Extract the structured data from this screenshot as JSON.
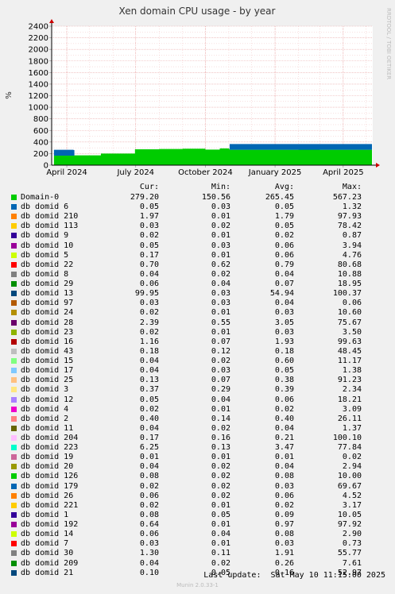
{
  "chart_data": {
    "type": "area",
    "title": "Xen domain CPU usage - by year",
    "ylabel": "%",
    "ylim": [
      0,
      2400
    ],
    "y_ticks": [
      0,
      200,
      400,
      600,
      800,
      1000,
      1200,
      1400,
      1600,
      1800,
      2000,
      2200,
      2400
    ],
    "x_range": [
      "2024-03-12",
      "2025-05-10"
    ],
    "x_ticks": [
      {
        "date": "2024-04-01",
        "label": "April 2024"
      },
      {
        "date": "2024-07-01",
        "label": "July 2024"
      },
      {
        "date": "2024-10-01",
        "label": "October 2024"
      },
      {
        "date": "2025-01-01",
        "label": "January 2025"
      },
      {
        "date": "2025-04-01",
        "label": "April 2025"
      }
    ],
    "side_label": "RRDTOOL / TOBI OETIKER",
    "grid": true,
    "stacked": true,
    "series": [
      {
        "name": "Domain-0",
        "color": "#00cc00",
        "x": [
          "2024-03-15",
          "2024-04-10",
          "2024-04-11",
          "2024-05-15",
          "2024-05-16",
          "2024-06-30",
          "2024-08-01",
          "2024-09-01",
          "2024-10-01",
          "2024-10-20",
          "2024-11-01",
          "2024-11-02",
          "2024-12-15",
          "2025-02-01",
          "2025-03-01",
          "2025-04-01",
          "2025-05-09"
        ],
        "values": [
          165,
          165,
          170,
          170,
          200,
          275,
          280,
          285,
          270,
          290,
          280,
          265,
          265,
          270,
          265,
          265,
          265
        ]
      },
      {
        "name": "db domid 13",
        "color": "#0066b3",
        "x": [
          "2024-03-15",
          "2024-04-10",
          "2024-04-11",
          "2024-11-01",
          "2024-11-02",
          "2025-05-09"
        ],
        "values": [
          100,
          95,
          0,
          0,
          100,
          100
        ]
      }
    ]
  },
  "legend": {
    "headers": [
      "Cur:",
      "Min:",
      "Avg:",
      "Max:"
    ],
    "rows": [
      {
        "name": "Domain-0",
        "color": "#00cc00",
        "cur": "279.20",
        "min": "150.56",
        "avg": "265.45",
        "max": "567.23"
      },
      {
        "name": "db domid 6",
        "color": "#0066b3",
        "cur": "0.05",
        "min": "0.03",
        "avg": "0.05",
        "max": "1.32"
      },
      {
        "name": "db domid 210",
        "color": "#ff8000",
        "cur": "1.97",
        "min": "0.01",
        "avg": "1.79",
        "max": "97.93"
      },
      {
        "name": "db domid 113",
        "color": "#ffcc00",
        "cur": "0.03",
        "min": "0.02",
        "avg": "0.05",
        "max": "78.42"
      },
      {
        "name": "db domid 9",
        "color": "#330099",
        "cur": "0.02",
        "min": "0.01",
        "avg": "0.02",
        "max": "0.87"
      },
      {
        "name": "db domid 10",
        "color": "#990099",
        "cur": "0.05",
        "min": "0.03",
        "avg": "0.06",
        "max": "3.94"
      },
      {
        "name": "db domid 5",
        "color": "#ccff00",
        "cur": "0.17",
        "min": "0.01",
        "avg": "0.06",
        "max": "4.76"
      },
      {
        "name": "db domid 22",
        "color": "#ff0000",
        "cur": "0.70",
        "min": "0.62",
        "avg": "0.79",
        "max": "80.68"
      },
      {
        "name": "db domid 8",
        "color": "#808080",
        "cur": "0.04",
        "min": "0.02",
        "avg": "0.04",
        "max": "10.88"
      },
      {
        "name": "db domid 29",
        "color": "#008f00",
        "cur": "0.06",
        "min": "0.04",
        "avg": "0.07",
        "max": "18.95"
      },
      {
        "name": "db domid 13",
        "color": "#00487d",
        "cur": "99.95",
        "min": "0.03",
        "avg": "54.94",
        "max": "100.37"
      },
      {
        "name": "db domid 97",
        "color": "#b35a00",
        "cur": "0.03",
        "min": "0.03",
        "avg": "0.04",
        "max": "0.06"
      },
      {
        "name": "db domid 24",
        "color": "#b38f00",
        "cur": "0.02",
        "min": "0.01",
        "avg": "0.03",
        "max": "10.60"
      },
      {
        "name": "db domid 28",
        "color": "#6b006b",
        "cur": "2.39",
        "min": "0.55",
        "avg": "3.05",
        "max": "75.67"
      },
      {
        "name": "db domid 23",
        "color": "#8fb300",
        "cur": "0.02",
        "min": "0.01",
        "avg": "0.03",
        "max": "3.50"
      },
      {
        "name": "db domid 16",
        "color": "#b30000",
        "cur": "1.16",
        "min": "0.07",
        "avg": "1.93",
        "max": "99.63"
      },
      {
        "name": "db domid 43",
        "color": "#bebebe",
        "cur": "0.18",
        "min": "0.12",
        "avg": "0.18",
        "max": "48.45"
      },
      {
        "name": "db domid 15",
        "color": "#80ff80",
        "cur": "0.04",
        "min": "0.02",
        "avg": "0.60",
        "max": "11.17"
      },
      {
        "name": "db domid 17",
        "color": "#80c9ff",
        "cur": "0.04",
        "min": "0.03",
        "avg": "0.05",
        "max": "1.38"
      },
      {
        "name": "db domid 25",
        "color": "#ffc080",
        "cur": "0.13",
        "min": "0.07",
        "avg": "0.38",
        "max": "91.23"
      },
      {
        "name": "db domid 3",
        "color": "#ffe680",
        "cur": "0.37",
        "min": "0.29",
        "avg": "0.39",
        "max": "2.34"
      },
      {
        "name": "db domid 12",
        "color": "#aa80ff",
        "cur": "0.05",
        "min": "0.04",
        "avg": "0.06",
        "max": "18.21"
      },
      {
        "name": "db domid 4",
        "color": "#ee00cc",
        "cur": "0.02",
        "min": "0.01",
        "avg": "0.02",
        "max": "3.09"
      },
      {
        "name": "db domid 2",
        "color": "#ff8080",
        "cur": "0.40",
        "min": "0.14",
        "avg": "0.40",
        "max": "26.11"
      },
      {
        "name": "db domid 11",
        "color": "#666600",
        "cur": "0.04",
        "min": "0.02",
        "avg": "0.04",
        "max": "1.37"
      },
      {
        "name": "db domid 204",
        "color": "#ffbfff",
        "cur": "0.17",
        "min": "0.16",
        "avg": "0.21",
        "max": "100.10"
      },
      {
        "name": "db domid 223",
        "color": "#00ffcc",
        "cur": "6.25",
        "min": "0.13",
        "avg": "3.47",
        "max": "77.84"
      },
      {
        "name": "db domid 19",
        "color": "#cc6699",
        "cur": "0.01",
        "min": "0.01",
        "avg": "0.01",
        "max": "0.02"
      },
      {
        "name": "db domid 20",
        "color": "#999900",
        "cur": "0.04",
        "min": "0.02",
        "avg": "0.04",
        "max": "2.94"
      },
      {
        "name": "db domid 126",
        "color": "#00cc00",
        "cur": "0.08",
        "min": "0.02",
        "avg": "0.08",
        "max": "10.00"
      },
      {
        "name": "db domid 179",
        "color": "#0066b3",
        "cur": "0.02",
        "min": "0.02",
        "avg": "0.03",
        "max": "69.67"
      },
      {
        "name": "db domid 26",
        "color": "#ff8000",
        "cur": "0.06",
        "min": "0.02",
        "avg": "0.06",
        "max": "4.52"
      },
      {
        "name": "db domid 221",
        "color": "#ffcc00",
        "cur": "0.02",
        "min": "0.01",
        "avg": "0.02",
        "max": "3.17"
      },
      {
        "name": "db domid 1",
        "color": "#330099",
        "cur": "0.08",
        "min": "0.05",
        "avg": "0.09",
        "max": "10.05"
      },
      {
        "name": "db domid 192",
        "color": "#990099",
        "cur": "0.64",
        "min": "0.01",
        "avg": "0.97",
        "max": "97.92"
      },
      {
        "name": "db domid 14",
        "color": "#ccff00",
        "cur": "0.06",
        "min": "0.04",
        "avg": "0.08",
        "max": "2.90"
      },
      {
        "name": "db domid 7",
        "color": "#ff0000",
        "cur": "0.03",
        "min": "0.01",
        "avg": "0.03",
        "max": "0.73"
      },
      {
        "name": "db domid 30",
        "color": "#808080",
        "cur": "1.30",
        "min": "0.11",
        "avg": "1.91",
        "max": "55.77"
      },
      {
        "name": "db domid 209",
        "color": "#008f00",
        "cur": "0.04",
        "min": "0.02",
        "avg": "0.26",
        "max": "7.61"
      },
      {
        "name": "db domid 21",
        "color": "#00487d",
        "cur": "0.10",
        "min": "0.05",
        "avg": "0.16",
        "max": "52.97"
      }
    ]
  },
  "footer": {
    "last_update": "Last update:  Sat May 10 11:15:00 2025",
    "generator": "Munin 2.0.33-1"
  }
}
